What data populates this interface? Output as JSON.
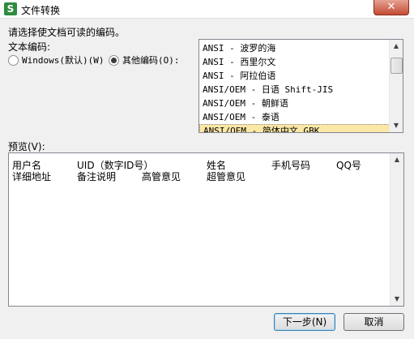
{
  "window": {
    "title": "文件转换",
    "app_icon_letter": "S",
    "close_glyph": "✕"
  },
  "instruction": "请选择使文档可读的编码。",
  "encoding_label": "文本编码:",
  "radio_windows": {
    "label": "Windows(默认)(W)",
    "checked": false
  },
  "radio_other": {
    "label": "其他编码(O):",
    "checked": true
  },
  "encoding_list": {
    "items": [
      "ANSI - 波罗的海",
      "ANSI - 西里尔文",
      "ANSI - 阿拉伯语",
      "ANSI/OEM - 日语 Shift-JIS",
      "ANSI/OEM - 朝鲜语",
      "ANSI/OEM - 泰语",
      "ANSI/OEM - 简体中文 GBK"
    ],
    "selected_index": 6
  },
  "preview_label": "预览(V):",
  "preview": {
    "row1": [
      "用户名",
      "UID（数字ID号）",
      "姓名",
      "手机号码",
      "QQ号"
    ],
    "row2": [
      "详细地址",
      "备注说明",
      "高管意见",
      "超管意见"
    ]
  },
  "buttons": {
    "next": "下一步(N)",
    "cancel": "取消"
  },
  "colors": {
    "selection": "#fbe7a6",
    "close_red": "#c44a33",
    "app_green": "#2f8c3e"
  }
}
